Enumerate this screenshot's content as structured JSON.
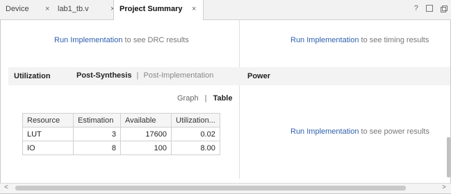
{
  "tabs": [
    {
      "label": "Device"
    },
    {
      "label": "lab1_tb.v"
    },
    {
      "label": "Project Summary"
    }
  ],
  "window_icons": {
    "help": "?"
  },
  "drc": {
    "link": "Run Implementation",
    "text": " to see DRC results"
  },
  "timing": {
    "link": "Run Implementation",
    "text": " to see timing results"
  },
  "utilization": {
    "title": "Utilization",
    "view_post_synthesis": "Post-Synthesis",
    "separator": "|",
    "view_post_implementation": "Post-Implementation",
    "graph": "Graph",
    "table_tab": "Table",
    "columns": [
      "Resource",
      "Estimation",
      "Available",
      "Utilization..."
    ],
    "rows": [
      {
        "resource": "LUT",
        "estimation": "3",
        "available": "17600",
        "utilization": "0.02"
      },
      {
        "resource": "IO",
        "estimation": "8",
        "available": "100",
        "utilization": "8.00"
      }
    ]
  },
  "power": {
    "title": "Power",
    "link": "Run Implementation",
    "text": " to see power results"
  },
  "colors": {
    "link": "#2e5fad",
    "header_bg": "#f3f3f3",
    "tabbar_bg": "#f2f2f2"
  }
}
